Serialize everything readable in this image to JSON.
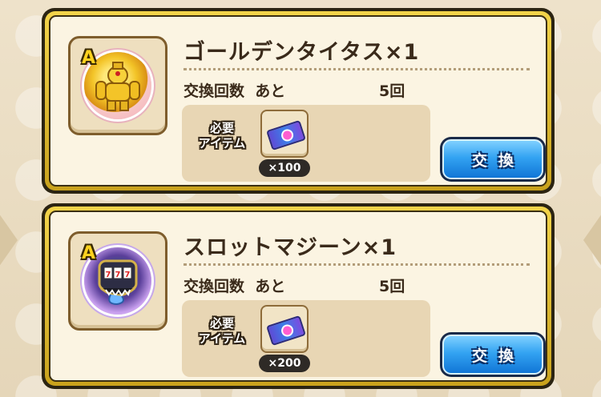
{
  "colors": {
    "card_gold": "#e0b92a",
    "card_inner": "#fbf4e2",
    "button_blue": "#33a3f2",
    "text_dark": "#3a2a1a"
  },
  "exchange_items": [
    {
      "rank": "A",
      "monster_icon": "golden-titan-monster-icon",
      "title": "ゴールデンタイタス×1",
      "count_label": "交換回数  あと",
      "count_value": "5回",
      "required_label": "必要\nアイテム",
      "required_item_icon": "ticket-icon",
      "required_qty": "×100",
      "button_label": "交換"
    },
    {
      "rank": "A",
      "monster_icon": "slot-magician-monster-icon",
      "title": "スロットマジーン×1",
      "count_label": "交換回数  あと",
      "count_value": "5回",
      "required_label": "必要\nアイテム",
      "required_item_icon": "ticket-icon",
      "required_qty": "×200",
      "button_label": "交換"
    }
  ]
}
